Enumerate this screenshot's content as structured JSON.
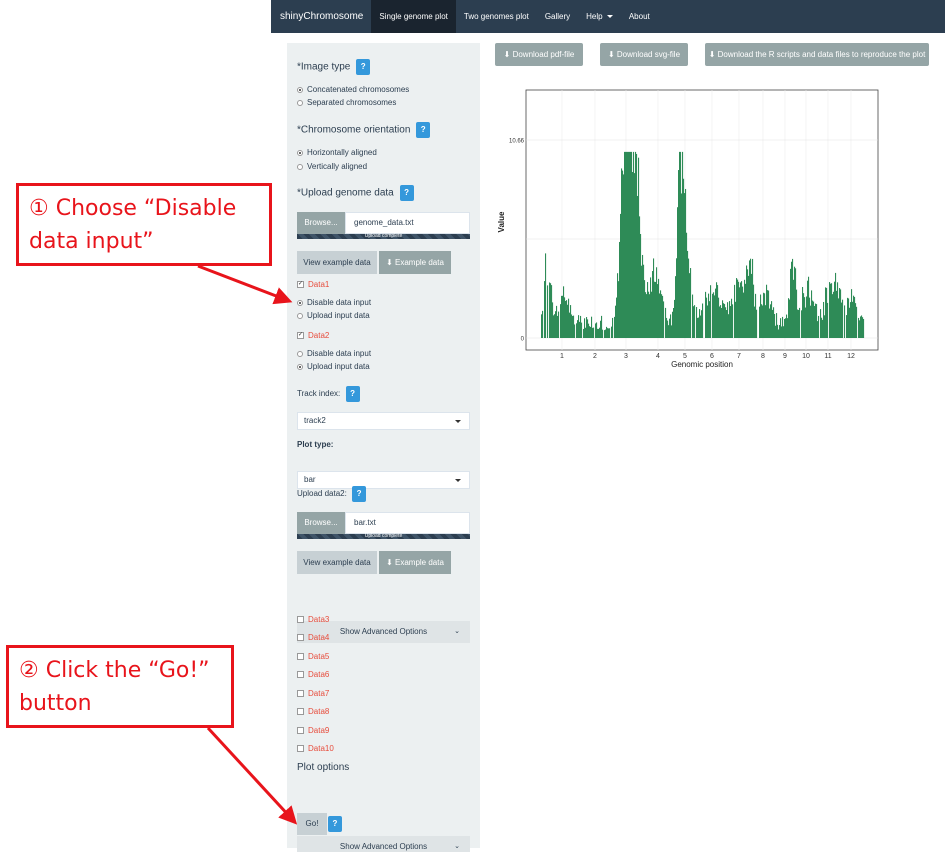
{
  "navbar": {
    "brand": "shinyChromosome",
    "items": [
      "Single genome plot",
      "Two genomes plot",
      "Gallery",
      "Help",
      "About"
    ]
  },
  "sidebar": {
    "image_type": {
      "label": "*Image type",
      "options": [
        "Concatenated chromosomes",
        "Separated chromosomes"
      ],
      "selected": 0
    },
    "orientation": {
      "label": "*Chromosome orientation",
      "options": [
        "Horizontally aligned",
        "Vertically aligned"
      ],
      "selected": 0
    },
    "upload": {
      "label": "*Upload genome data",
      "browse": "Browse...",
      "filename": "genome_data.txt",
      "progress": "Upload complete",
      "view_example": "View example data",
      "example": "Example data"
    },
    "data1": {
      "label": "Data1",
      "checked": true,
      "options": [
        "Disable data input",
        "Upload input data"
      ],
      "selected": 0
    },
    "data2": {
      "label": "Data2",
      "checked": true,
      "options": [
        "Disable data input",
        "Upload input data"
      ],
      "selected": 1
    },
    "track_index": {
      "label": "Track index:",
      "value": "track2"
    },
    "plot_type": {
      "label": "Plot type:",
      "value": "bar"
    },
    "upload2": {
      "label": "Upload data2:",
      "browse": "Browse...",
      "filename": "bar.txt",
      "progress": "Upload complete",
      "view_example": "View example data",
      "example": "Example data"
    },
    "advanced_label": "Show Advanced Options",
    "extra_data": [
      "Data3",
      "Data4",
      "Data5",
      "Data6",
      "Data7",
      "Data8",
      "Data9",
      "Data10"
    ],
    "plot_options": "Plot options",
    "go": "Go!",
    "help": "?"
  },
  "downloads": [
    "Download pdf-file",
    "Download svg-file",
    "Download the R scripts and data files to reproduce the plot"
  ],
  "chart_data": {
    "type": "bar",
    "xlabel": "Genomic position",
    "ylabel": "Value",
    "x_ticks": [
      "1",
      "2",
      "3",
      "4",
      "5",
      "6",
      "7",
      "8",
      "9",
      "10",
      "11",
      "12"
    ],
    "y_ticks": [
      "0",
      "10.66"
    ],
    "ylim": [
      0,
      10.66
    ],
    "bar_color": "#2e8b57",
    "grid": true
  },
  "annotations": {
    "step1": [
      "① Choose “Disable",
      "data input”"
    ],
    "step2": [
      "② Click the “Go!”",
      "button"
    ]
  },
  "colors": {
    "navbar": "#2c3e50",
    "accent": "#3498db",
    "annotation": "#e8141b",
    "sidebar": "#ecf0f1"
  }
}
